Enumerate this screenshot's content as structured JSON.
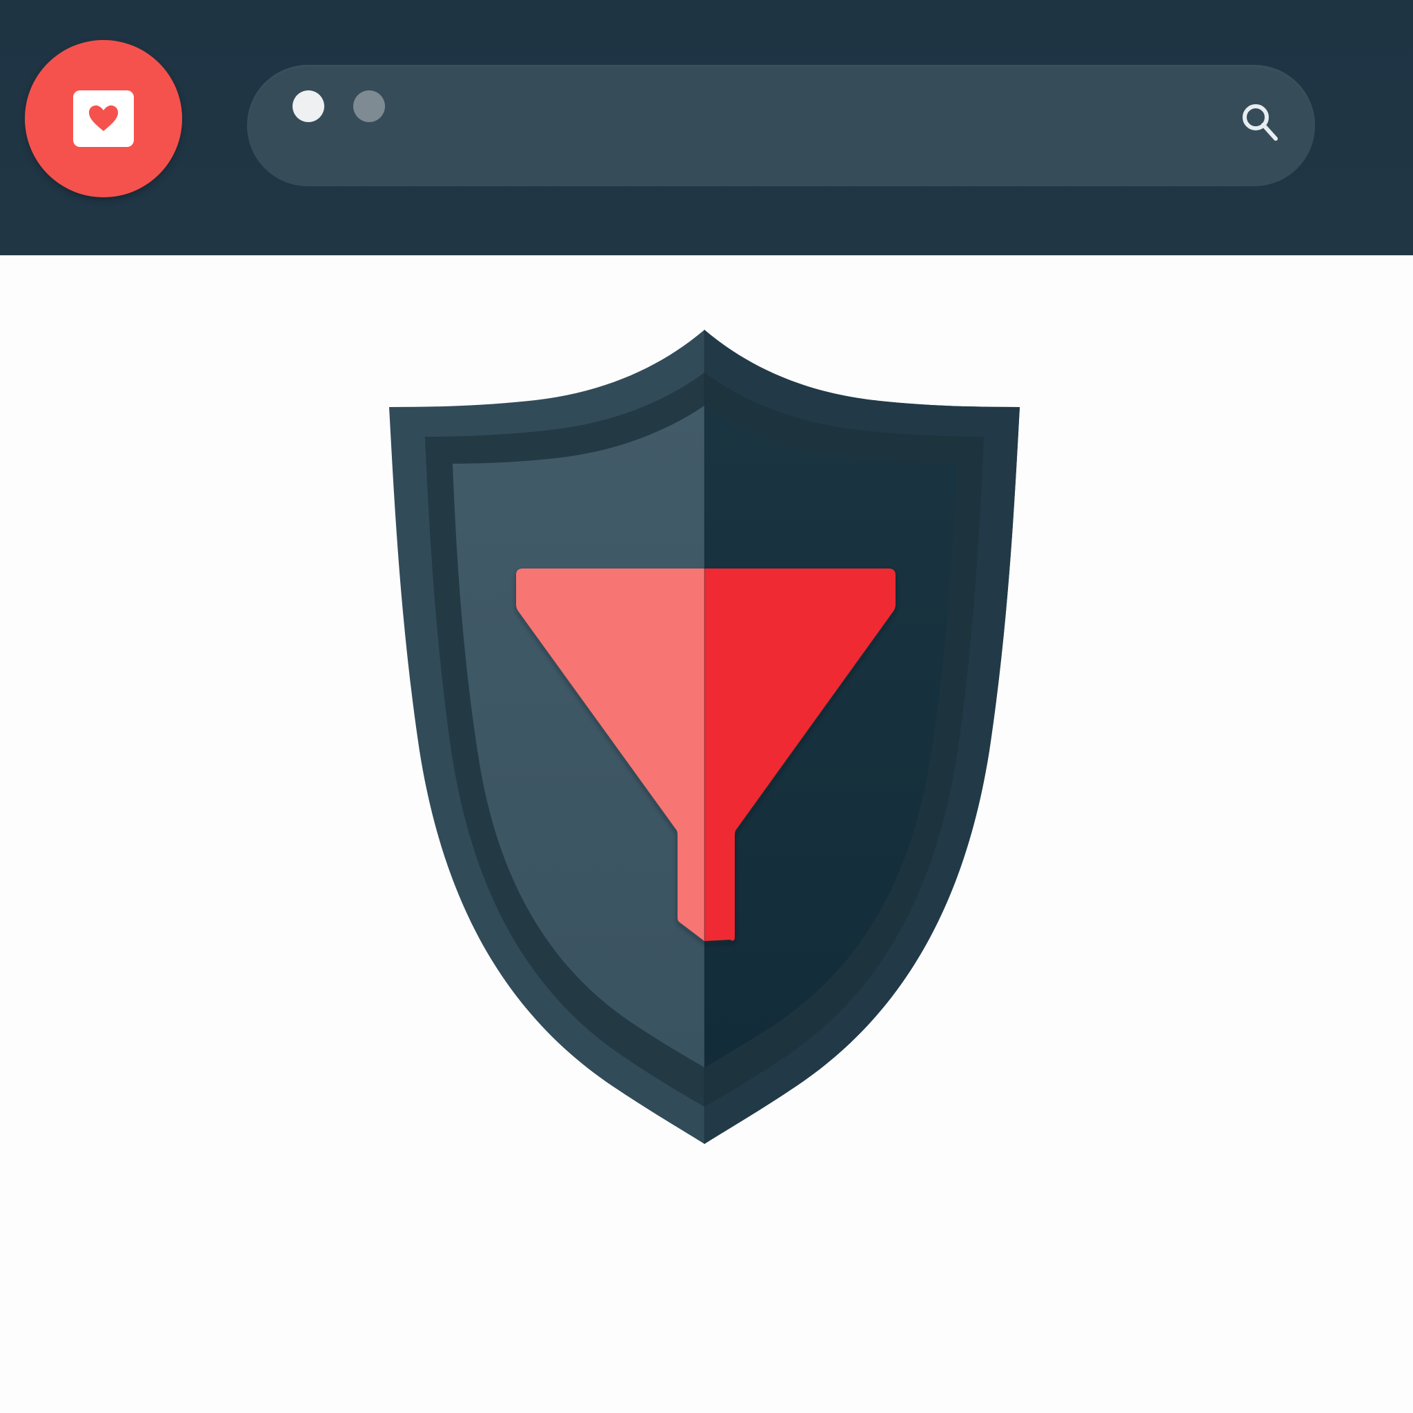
{
  "header": {
    "logo_icon": "heart-card-icon",
    "search": {
      "value": "",
      "placeholder": "",
      "icon": "search-icon"
    },
    "window_dots": [
      "light",
      "gray"
    ]
  },
  "main": {
    "illustration": "shield-filter-icon"
  },
  "colors": {
    "header_bg": "#1f3443",
    "search_bg": "#374c59",
    "accent_red": "#f5524d",
    "shield_left": "#3e5766",
    "shield_right": "#18303e",
    "filter_left": "#f77573",
    "filter_right": "#ef2b33",
    "page_bg": "#fdfdfd"
  }
}
